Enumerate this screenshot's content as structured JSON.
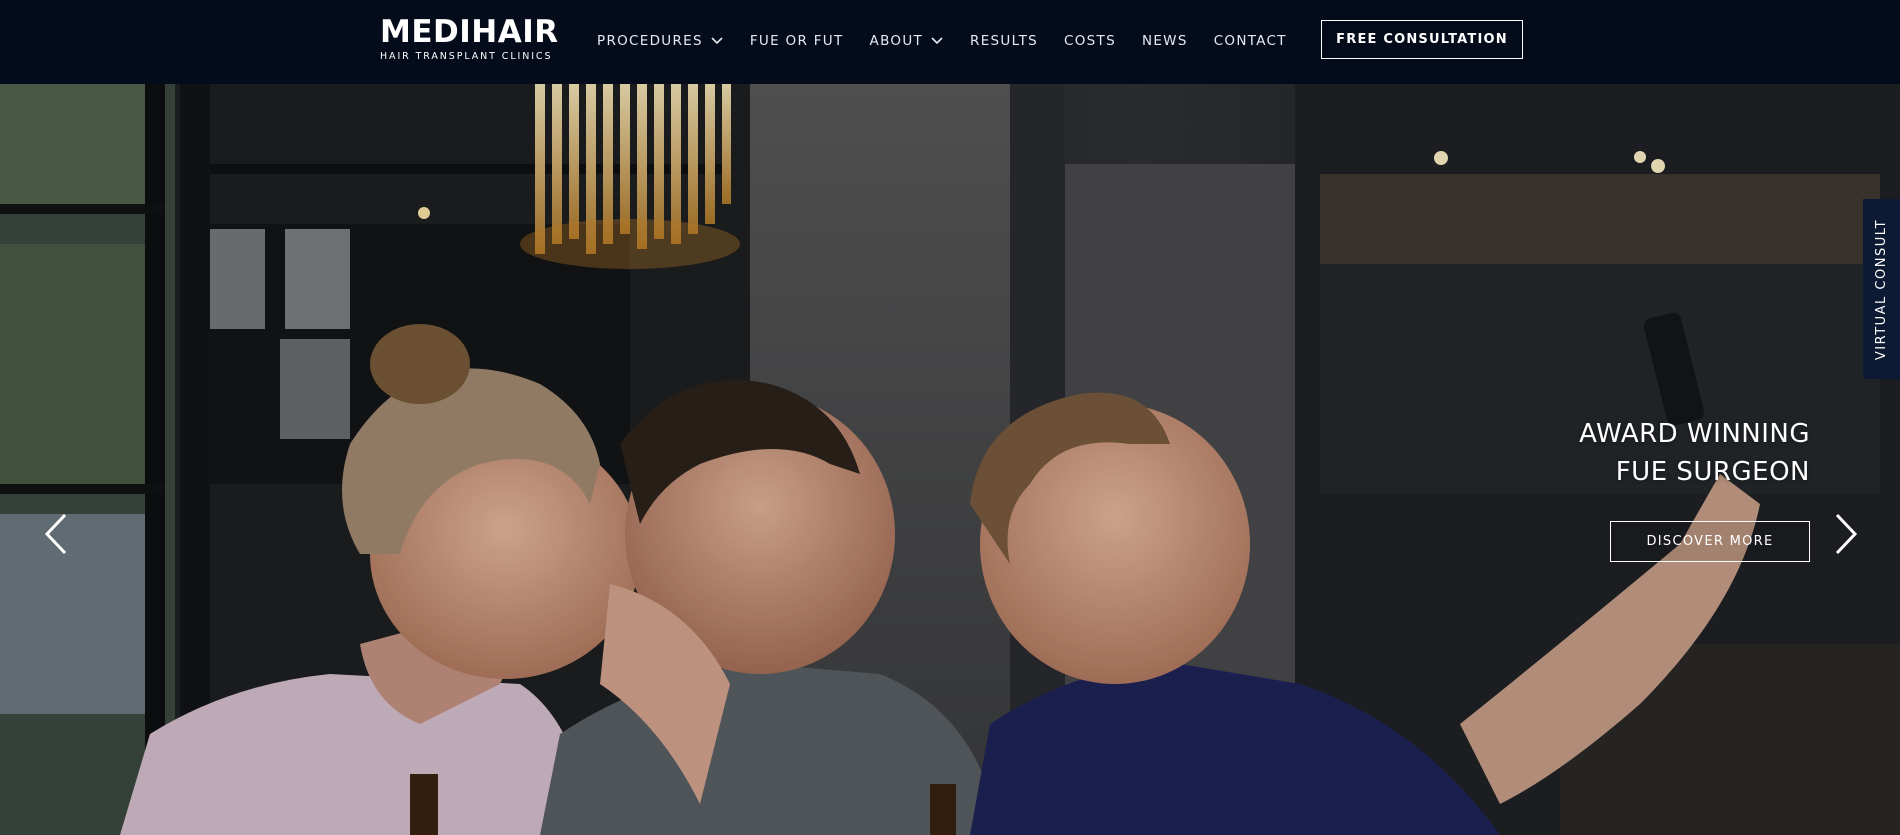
{
  "brand": {
    "name": "MEDIHAIR",
    "tagline": "HAIR TRANSPLANT CLINICS"
  },
  "nav": {
    "items": [
      {
        "label": "PROCEDURES",
        "has_dropdown": true
      },
      {
        "label": "FUE OR FUT",
        "has_dropdown": false
      },
      {
        "label": "ABOUT",
        "has_dropdown": true
      },
      {
        "label": "RESULTS",
        "has_dropdown": false
      },
      {
        "label": "COSTS",
        "has_dropdown": false
      },
      {
        "label": "NEWS",
        "has_dropdown": false
      },
      {
        "label": "CONTACT",
        "has_dropdown": false
      }
    ],
    "cta_label": "FREE CONSULTATION"
  },
  "hero": {
    "headline_line1": "AWARD WINNING",
    "headline_line2": "FUE SURGEON",
    "button_label": "DISCOVER MORE",
    "prev_icon": "chevron-left-icon",
    "next_icon": "chevron-right-icon"
  },
  "side_tab": {
    "label": "VIRTUAL CONSULT"
  },
  "colors": {
    "header_bg": "#040c1c",
    "side_tab_bg": "#0d1a33",
    "text": "#ffffff"
  }
}
